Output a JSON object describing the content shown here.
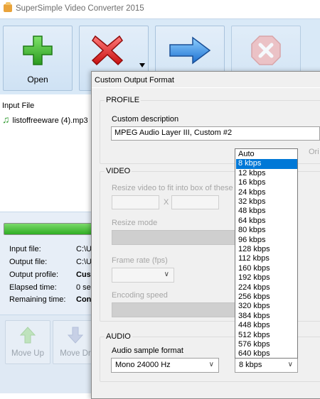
{
  "app": {
    "title": "SuperSimple Video Converter 2015"
  },
  "toolbar": {
    "open_label": "Open"
  },
  "filelist": {
    "header": "Input File",
    "files": [
      "listoffreeware (4).mp3"
    ]
  },
  "progress": {
    "level": 1.0,
    "labels": [
      "Input file:",
      "Output file:",
      "Output profile:",
      "Elapsed time:",
      "Remaining time:"
    ],
    "values": [
      "C:\\U",
      "C:\\U",
      "Cust",
      "0 se",
      "Con"
    ]
  },
  "bottom": {
    "move_up": "Move Up",
    "move_down": "Move Dr"
  },
  "dialog": {
    "title": "Custom Output Format",
    "profile": {
      "title": "PROFILE",
      "desc_label": "Custom description",
      "desc_value": "MPEG Audio Layer III, Custom #2",
      "side_text": "Ori"
    },
    "video": {
      "title": "VIDEO",
      "resize_label": "Resize video to fit into box of these d",
      "x_sep": "X",
      "mode_label": "Resize mode",
      "fps_label": "Frame rate (fps)",
      "speed_label": "Encoding speed"
    },
    "audio": {
      "title": "AUDIO",
      "sample_label": "Audio sample format",
      "sample_value": "Mono  24000 Hz",
      "bitrate_value": "8 kbps"
    }
  },
  "bitrate_options": [
    "Auto",
    "8 kbps",
    "12 kbps",
    "16 kbps",
    "24 kbps",
    "32 kbps",
    "48 kbps",
    "64 kbps",
    "80 kbps",
    "96 kbps",
    "128 kbps",
    "112 kbps",
    "160 kbps",
    "192 kbps",
    "224 kbps",
    "256 kbps",
    "320 kbps",
    "384 kbps",
    "448 kbps",
    "512 kbps",
    "576 kbps",
    "640 kbps"
  ],
  "bitrate_selected": "8 kbps",
  "colors": {
    "accent": "#0078d7",
    "toolbar": "#d9e9f7",
    "progress": "#2fae24"
  }
}
